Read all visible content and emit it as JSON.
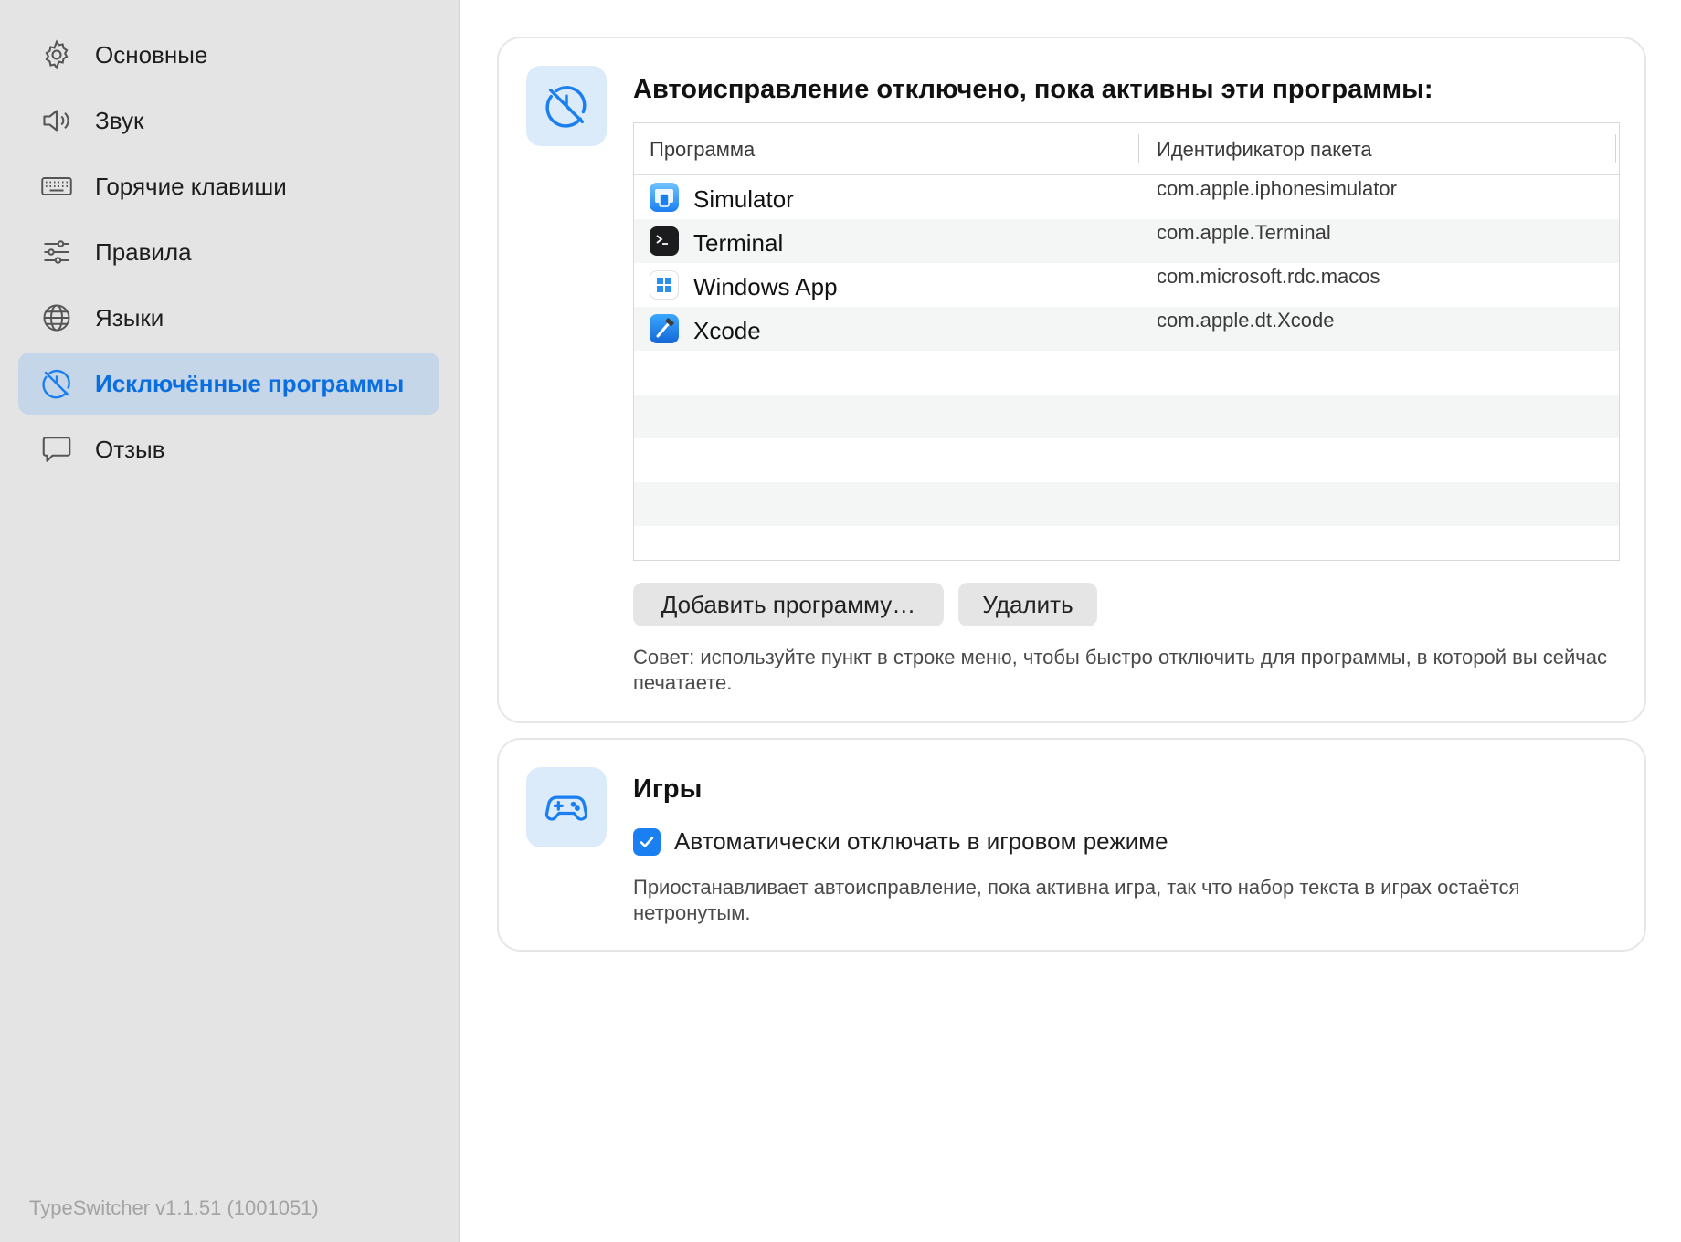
{
  "sidebar": {
    "items": [
      {
        "label": "Основные",
        "icon": "gear-icon"
      },
      {
        "label": "Звук",
        "icon": "speaker-icon"
      },
      {
        "label": "Горячие клавиши",
        "icon": "keyboard-icon"
      },
      {
        "label": "Правила",
        "icon": "sliders-icon"
      },
      {
        "label": "Языки",
        "icon": "globe-icon"
      },
      {
        "label": "Исключённые программы",
        "icon": "disabled-icon",
        "active": true
      },
      {
        "label": "Отзыв",
        "icon": "speech-bubble-icon"
      }
    ],
    "version": "TypeSwitcher v1.1.51 (1001051)"
  },
  "excluded": {
    "title": "Автоисправление отключено, пока активны эти программы:",
    "columns": [
      "Программа",
      "Идентификатор пакета"
    ],
    "apps": [
      {
        "name": "Simulator",
        "bundle": "com.apple.iphonesimulator",
        "icon": "simulator-icon"
      },
      {
        "name": "Terminal",
        "bundle": "com.apple.Terminal",
        "icon": "terminal-icon"
      },
      {
        "name": "Windows App",
        "bundle": "com.microsoft.rdc.macos",
        "icon": "windows-app-icon"
      },
      {
        "name": "Xcode",
        "bundle": "com.apple.dt.Xcode",
        "icon": "xcode-icon"
      }
    ],
    "add_button": "Добавить программу…",
    "delete_button": "Удалить",
    "hint": "Совет: используйте пункт в строке меню, чтобы быстро отключить для программы, в которой вы сейчас печатаете."
  },
  "games": {
    "title": "Игры",
    "checkbox_label": "Автоматически отключать в игровом режиме",
    "checked": true,
    "description": "Приостанавливает автоисправление, пока активна игра, так что набор текста в играх остаётся нетронутым."
  },
  "colors": {
    "accent": "#1a7ff0",
    "sidebar_bg": "#e4e4e4",
    "active_item_bg": "#c5d6e8",
    "icon_tile_bg": "#dcebf9"
  }
}
